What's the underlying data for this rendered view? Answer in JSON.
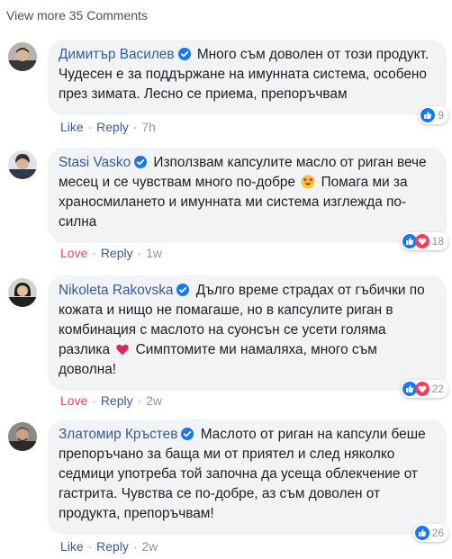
{
  "view_more_label": "View more 35 Comments",
  "comments": [
    {
      "author": "Димитър Василев",
      "text": "Много съм доволен от този продукт. Чудесен е за поддържане на имунната система, особено през зимата. Лесно се приема, препоръчвам",
      "reaction_label": "Like",
      "reply_label": "Reply",
      "time": "7h",
      "reaction_icons": [
        "like-icon"
      ],
      "reaction_count": "9"
    },
    {
      "author": "Stasi Vasko",
      "text_before": "Използвам капсулите масло от риган вече месец и се чувствам много по-добре",
      "emoji": "heart-eyes-emoji",
      "text_after": "Помага ми за храносмилането и имунната ми система изглежда по-силна",
      "reaction_label": "Love",
      "reply_label": "Reply",
      "time": "1w",
      "reaction_icons": [
        "like-icon",
        "love-icon"
      ],
      "reaction_count": "18"
    },
    {
      "author": "Nikoleta Rakovska",
      "text_before": "Дълго време страдах от гъбички по кожата и нищо не помагаше, но в капсулите риган в комбинация с маслото на суонсън се усети голяма разлика",
      "emoji": "red-heart-emoji",
      "text_after": "Симптомите ми намаляха, много съм доволна!",
      "reaction_label": "Love",
      "reply_label": "Reply",
      "time": "2w",
      "reaction_icons": [
        "like-icon",
        "love-icon"
      ],
      "reaction_count": "22"
    },
    {
      "author": "Златомир Кръстев",
      "text": "Маслото от риган на капсули беше препоръчано за баща ми от приятел и след няколко седмици употреба той започна да усеща облекчение от гастрита. Чувства се по-добре, аз съм доволен от продукта, препоръчвам!",
      "reaction_label": "Like",
      "reply_label": "Reply",
      "time": "2w",
      "reaction_icons": [
        "like-icon"
      ],
      "reaction_count": "26"
    }
  ],
  "separator": "·",
  "colors": {
    "link": "#385898",
    "love": "#f33e58",
    "bubble": "#f2f3f5",
    "muted": "#90949c",
    "like_blue": "#1877f2"
  }
}
